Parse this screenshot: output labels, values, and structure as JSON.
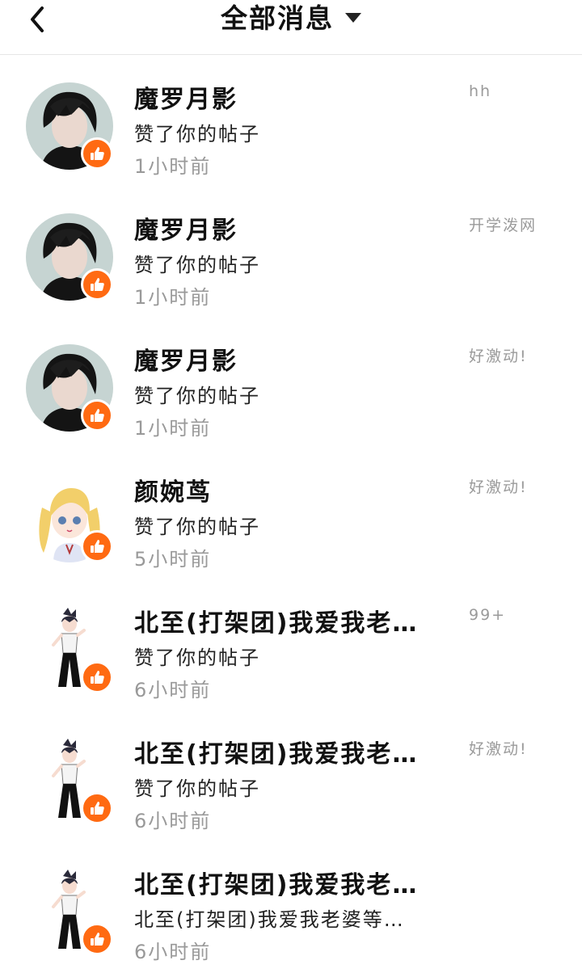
{
  "header": {
    "title": "全部消息"
  },
  "messages": [
    {
      "name": "魔罗月影",
      "action": "赞了你的帖子",
      "time": "1小时前",
      "preview": "hh",
      "avatar": "male-dark-hair"
    },
    {
      "name": "魔罗月影",
      "action": "赞了你的帖子",
      "time": "1小时前",
      "preview": "开学泼网",
      "avatar": "male-dark-hair"
    },
    {
      "name": "魔罗月影",
      "action": "赞了你的帖子",
      "time": "1小时前",
      "preview": "好激动!",
      "avatar": "male-dark-hair"
    },
    {
      "name": "颜婉茑",
      "action": "赞了你的帖子",
      "time": "5小时前",
      "preview": "好激动!",
      "avatar": "blonde-girl"
    },
    {
      "name": "北至(打架团)我爱我老…",
      "action": "赞了你的帖子",
      "time": "6小时前",
      "preview": "99+",
      "avatar": "chibi-boy"
    },
    {
      "name": "北至(打架团)我爱我老…",
      "action": "赞了你的帖子",
      "time": "6小时前",
      "preview": "好激动!",
      "avatar": "chibi-boy"
    },
    {
      "name": "北至(打架团)我爱我老…",
      "action": "北至(打架团)我爱我老婆等…",
      "time": "6小时前",
      "preview": "",
      "avatar": "chibi-boy"
    }
  ],
  "icons": {
    "back": "chevron-left-icon",
    "dropdown": "caret-down-icon",
    "badge": "thumbs-up-icon"
  },
  "colors": {
    "badge": "#ff6a12",
    "muted": "#999999"
  }
}
